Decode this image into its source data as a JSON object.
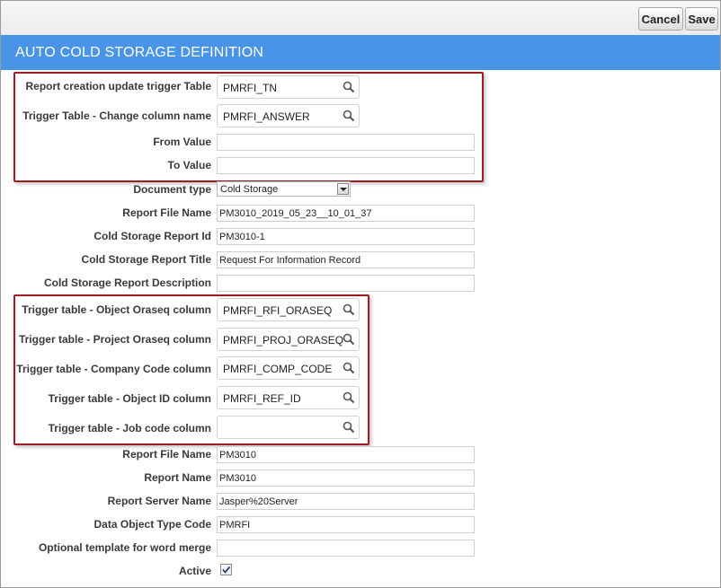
{
  "toolbar": {
    "cancel_label": "Cancel",
    "save_label": "Save"
  },
  "header": {
    "title": "AUTO COLD STORAGE DEFINITION"
  },
  "accent_color": "#4a94e8",
  "highlight_color": "#a21a24",
  "form": {
    "report_creation_table": {
      "label": "Report creation update trigger Table",
      "value": "PMRFI_TN"
    },
    "trigger_change_column": {
      "label": "Trigger Table - Change column name",
      "value": "PMRFI_ANSWER"
    },
    "from_value": {
      "label": "From Value",
      "value": ""
    },
    "to_value": {
      "label": "To Value",
      "value": ""
    },
    "document_type": {
      "label": "Document type",
      "value": "Cold Storage"
    },
    "report_file_name_1": {
      "label": "Report File Name",
      "value": "PM3010_2019_05_23__10_01_37"
    },
    "cold_storage_report_id": {
      "label": "Cold Storage Report Id",
      "value": "PM3010-1"
    },
    "cold_storage_report_title": {
      "label": "Cold Storage Report Title",
      "value": "Request For Information Record"
    },
    "cold_storage_report_description": {
      "label": "Cold Storage Report Description",
      "value": ""
    },
    "object_oraseq_column": {
      "label": "Trigger table - Object Oraseq column",
      "value": "PMRFI_RFI_ORASEQ"
    },
    "project_oraseq_column": {
      "label": "Trigger table - Project Oraseq column",
      "value": "PMRFI_PROJ_ORASEQ"
    },
    "company_code_column": {
      "label": "Trigger table - Company Code column",
      "value": "PMRFI_COMP_CODE"
    },
    "object_id_column": {
      "label": "Trigger table - Object ID column",
      "value": "PMRFI_REF_ID"
    },
    "job_code_column": {
      "label": "Trigger table - Job code column",
      "value": ""
    },
    "report_file_name_2": {
      "label": "Report File Name",
      "value": "PM3010"
    },
    "report_name": {
      "label": "Report Name",
      "value": "PM3010"
    },
    "report_server_name": {
      "label": "Report Server Name",
      "value": "Jasper%20Server"
    },
    "data_object_type_code": {
      "label": "Data Object Type Code",
      "value": "PMRFI"
    },
    "word_merge_template": {
      "label": "Optional template for word merge",
      "value": ""
    },
    "active": {
      "label": "Active",
      "checked": true
    }
  }
}
